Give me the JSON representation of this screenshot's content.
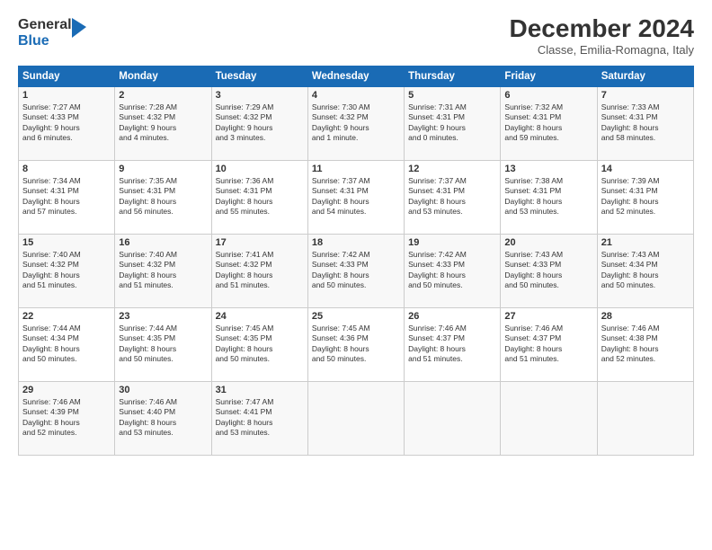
{
  "header": {
    "logo_line1": "General",
    "logo_line2": "Blue",
    "month": "December 2024",
    "location": "Classe, Emilia-Romagna, Italy"
  },
  "columns": [
    "Sunday",
    "Monday",
    "Tuesday",
    "Wednesday",
    "Thursday",
    "Friday",
    "Saturday"
  ],
  "weeks": [
    [
      {
        "day": "1",
        "lines": [
          "Sunrise: 7:27 AM",
          "Sunset: 4:33 PM",
          "Daylight: 9 hours",
          "and 6 minutes."
        ]
      },
      {
        "day": "2",
        "lines": [
          "Sunrise: 7:28 AM",
          "Sunset: 4:32 PM",
          "Daylight: 9 hours",
          "and 4 minutes."
        ]
      },
      {
        "day": "3",
        "lines": [
          "Sunrise: 7:29 AM",
          "Sunset: 4:32 PM",
          "Daylight: 9 hours",
          "and 3 minutes."
        ]
      },
      {
        "day": "4",
        "lines": [
          "Sunrise: 7:30 AM",
          "Sunset: 4:32 PM",
          "Daylight: 9 hours",
          "and 1 minute."
        ]
      },
      {
        "day": "5",
        "lines": [
          "Sunrise: 7:31 AM",
          "Sunset: 4:31 PM",
          "Daylight: 9 hours",
          "and 0 minutes."
        ]
      },
      {
        "day": "6",
        "lines": [
          "Sunrise: 7:32 AM",
          "Sunset: 4:31 PM",
          "Daylight: 8 hours",
          "and 59 minutes."
        ]
      },
      {
        "day": "7",
        "lines": [
          "Sunrise: 7:33 AM",
          "Sunset: 4:31 PM",
          "Daylight: 8 hours",
          "and 58 minutes."
        ]
      }
    ],
    [
      {
        "day": "8",
        "lines": [
          "Sunrise: 7:34 AM",
          "Sunset: 4:31 PM",
          "Daylight: 8 hours",
          "and 57 minutes."
        ]
      },
      {
        "day": "9",
        "lines": [
          "Sunrise: 7:35 AM",
          "Sunset: 4:31 PM",
          "Daylight: 8 hours",
          "and 56 minutes."
        ]
      },
      {
        "day": "10",
        "lines": [
          "Sunrise: 7:36 AM",
          "Sunset: 4:31 PM",
          "Daylight: 8 hours",
          "and 55 minutes."
        ]
      },
      {
        "day": "11",
        "lines": [
          "Sunrise: 7:37 AM",
          "Sunset: 4:31 PM",
          "Daylight: 8 hours",
          "and 54 minutes."
        ]
      },
      {
        "day": "12",
        "lines": [
          "Sunrise: 7:37 AM",
          "Sunset: 4:31 PM",
          "Daylight: 8 hours",
          "and 53 minutes."
        ]
      },
      {
        "day": "13",
        "lines": [
          "Sunrise: 7:38 AM",
          "Sunset: 4:31 PM",
          "Daylight: 8 hours",
          "and 53 minutes."
        ]
      },
      {
        "day": "14",
        "lines": [
          "Sunrise: 7:39 AM",
          "Sunset: 4:31 PM",
          "Daylight: 8 hours",
          "and 52 minutes."
        ]
      }
    ],
    [
      {
        "day": "15",
        "lines": [
          "Sunrise: 7:40 AM",
          "Sunset: 4:32 PM",
          "Daylight: 8 hours",
          "and 51 minutes."
        ]
      },
      {
        "day": "16",
        "lines": [
          "Sunrise: 7:40 AM",
          "Sunset: 4:32 PM",
          "Daylight: 8 hours",
          "and 51 minutes."
        ]
      },
      {
        "day": "17",
        "lines": [
          "Sunrise: 7:41 AM",
          "Sunset: 4:32 PM",
          "Daylight: 8 hours",
          "and 51 minutes."
        ]
      },
      {
        "day": "18",
        "lines": [
          "Sunrise: 7:42 AM",
          "Sunset: 4:33 PM",
          "Daylight: 8 hours",
          "and 50 minutes."
        ]
      },
      {
        "day": "19",
        "lines": [
          "Sunrise: 7:42 AM",
          "Sunset: 4:33 PM",
          "Daylight: 8 hours",
          "and 50 minutes."
        ]
      },
      {
        "day": "20",
        "lines": [
          "Sunrise: 7:43 AM",
          "Sunset: 4:33 PM",
          "Daylight: 8 hours",
          "and 50 minutes."
        ]
      },
      {
        "day": "21",
        "lines": [
          "Sunrise: 7:43 AM",
          "Sunset: 4:34 PM",
          "Daylight: 8 hours",
          "and 50 minutes."
        ]
      }
    ],
    [
      {
        "day": "22",
        "lines": [
          "Sunrise: 7:44 AM",
          "Sunset: 4:34 PM",
          "Daylight: 8 hours",
          "and 50 minutes."
        ]
      },
      {
        "day": "23",
        "lines": [
          "Sunrise: 7:44 AM",
          "Sunset: 4:35 PM",
          "Daylight: 8 hours",
          "and 50 minutes."
        ]
      },
      {
        "day": "24",
        "lines": [
          "Sunrise: 7:45 AM",
          "Sunset: 4:35 PM",
          "Daylight: 8 hours",
          "and 50 minutes."
        ]
      },
      {
        "day": "25",
        "lines": [
          "Sunrise: 7:45 AM",
          "Sunset: 4:36 PM",
          "Daylight: 8 hours",
          "and 50 minutes."
        ]
      },
      {
        "day": "26",
        "lines": [
          "Sunrise: 7:46 AM",
          "Sunset: 4:37 PM",
          "Daylight: 8 hours",
          "and 51 minutes."
        ]
      },
      {
        "day": "27",
        "lines": [
          "Sunrise: 7:46 AM",
          "Sunset: 4:37 PM",
          "Daylight: 8 hours",
          "and 51 minutes."
        ]
      },
      {
        "day": "28",
        "lines": [
          "Sunrise: 7:46 AM",
          "Sunset: 4:38 PM",
          "Daylight: 8 hours",
          "and 52 minutes."
        ]
      }
    ],
    [
      {
        "day": "29",
        "lines": [
          "Sunrise: 7:46 AM",
          "Sunset: 4:39 PM",
          "Daylight: 8 hours",
          "and 52 minutes."
        ]
      },
      {
        "day": "30",
        "lines": [
          "Sunrise: 7:46 AM",
          "Sunset: 4:40 PM",
          "Daylight: 8 hours",
          "and 53 minutes."
        ]
      },
      {
        "day": "31",
        "lines": [
          "Sunrise: 7:47 AM",
          "Sunset: 4:41 PM",
          "Daylight: 8 hours",
          "and 53 minutes."
        ]
      },
      null,
      null,
      null,
      null
    ]
  ]
}
